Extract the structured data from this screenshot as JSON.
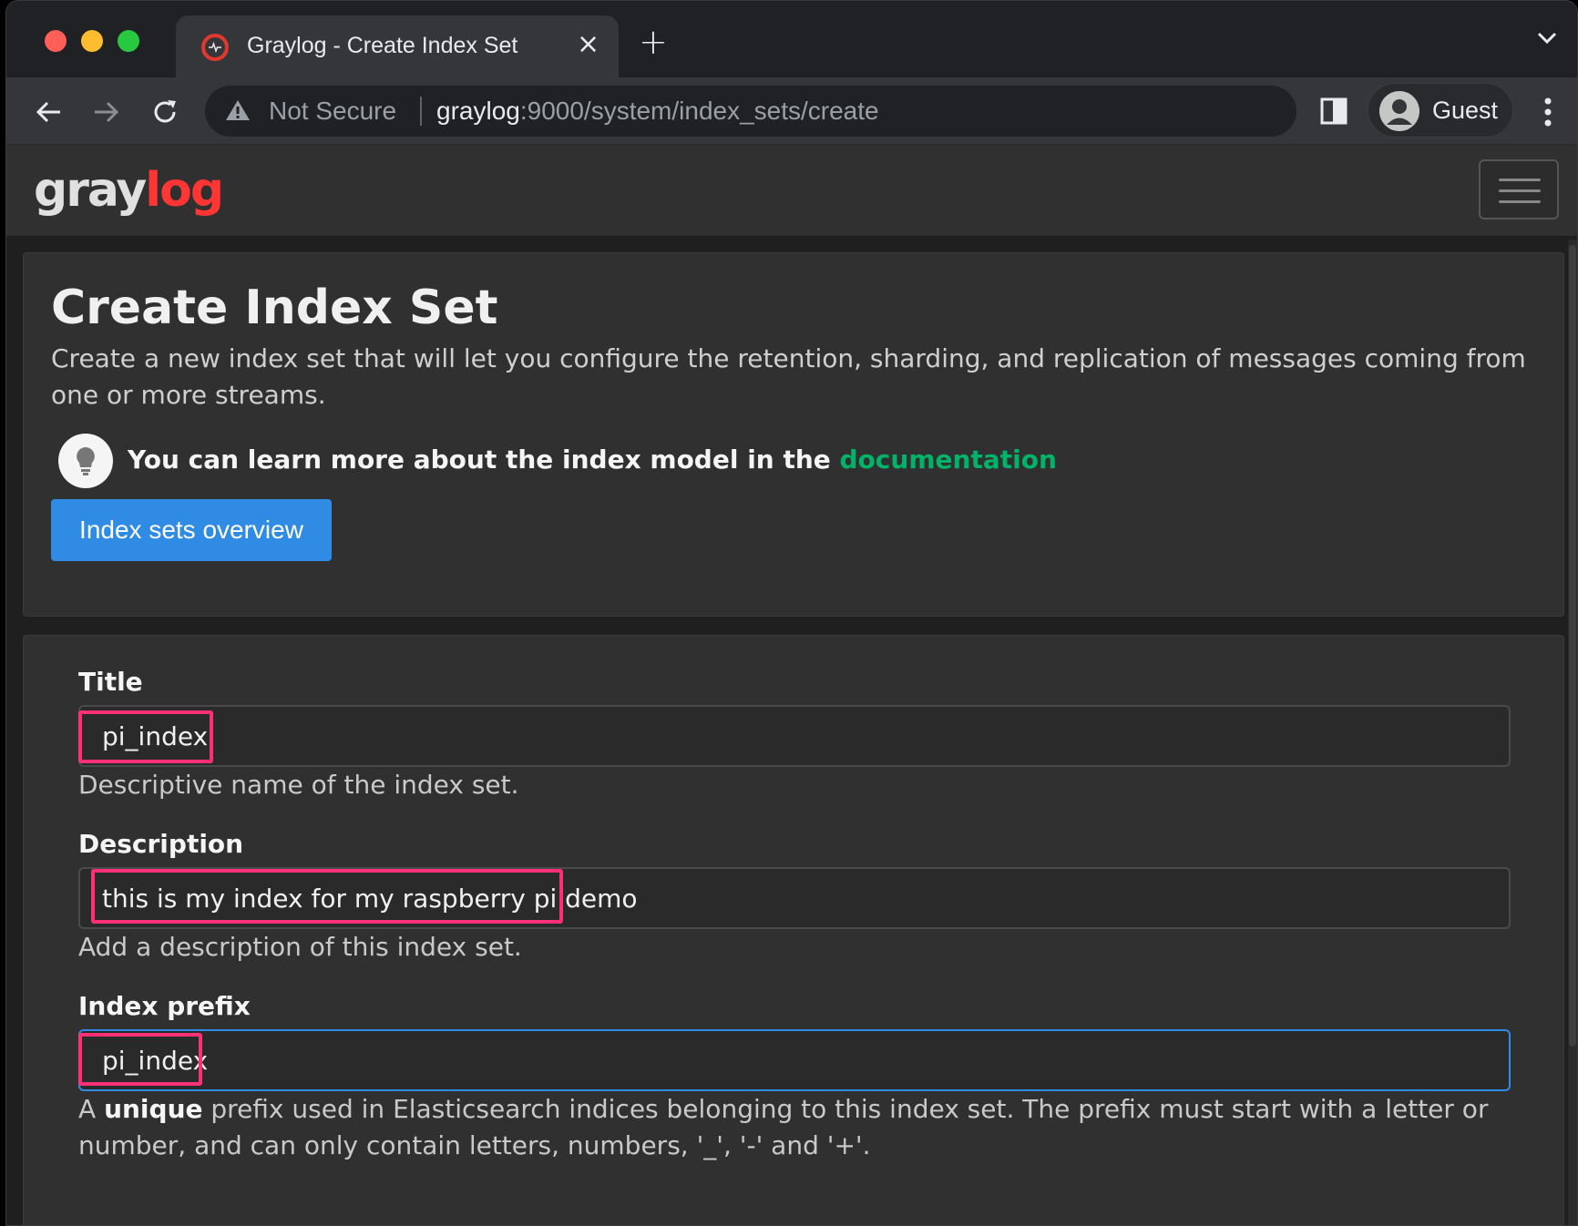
{
  "browser": {
    "tab_title": "Graylog - Create Index Set",
    "tab_close": "×",
    "new_tab": "+",
    "security_label": "Not Secure",
    "url_host": "graylog",
    "url_rest": ":9000/system/index_sets/create",
    "profile_name": "Guest"
  },
  "navbar": {
    "logo_part1": "gray",
    "logo_part2": "log"
  },
  "header": {
    "title": "Create Index Set",
    "description": "Create a new index set that will let you configure the retention, sharding, and replication of messages coming from one or more streams.",
    "tip_text": "You can learn more about the index model in the ",
    "tip_link": "documentation",
    "overview_button": "Index sets overview"
  },
  "form": {
    "title_label": "Title",
    "title_value": "pi_index",
    "title_help": "Descriptive name of the index set.",
    "description_label": "Description",
    "description_value": "this is my index for my raspberry pi demo",
    "description_help": "Add a description of this index set.",
    "prefix_label": "Index prefix",
    "prefix_value": "pi_index",
    "prefix_help_a": "A ",
    "prefix_help_bold": "unique",
    "prefix_help_b": " prefix used in Elasticsearch indices belonging to this index set. The prefix must start with a letter or number, and can only contain letters, numbers, '_', '-' and '+'."
  },
  "colors": {
    "accent": "#2f8be4",
    "link": "#00b368",
    "highlight": "#ff2f78",
    "logo_red": "#ff3633"
  }
}
